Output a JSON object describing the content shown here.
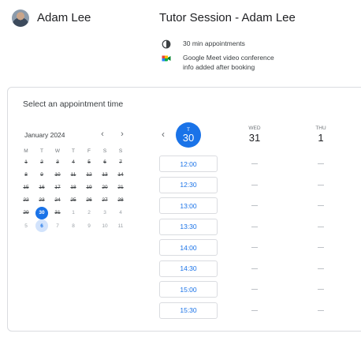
{
  "host": {
    "name": "Adam Lee"
  },
  "session": {
    "title": "Tutor Session - Adam Lee",
    "duration": "30 min appointments",
    "conference_line1": "Google Meet video conference",
    "conference_line2": "info added after booking",
    "icons": [
      "timer-icon",
      "google-meet-icon"
    ]
  },
  "picker": {
    "heading": "Select an appointment time",
    "month": "January 2024",
    "prev": "‹",
    "next": "›",
    "weekdays": [
      "M",
      "T",
      "W",
      "T",
      "F",
      "S",
      "S"
    ],
    "weeks": [
      [
        {
          "d": "1",
          "s": "past"
        },
        {
          "d": "2",
          "s": "past"
        },
        {
          "d": "3",
          "s": "past"
        },
        {
          "d": "4",
          "s": "past"
        },
        {
          "d": "5",
          "s": "past"
        },
        {
          "d": "6",
          "s": "past"
        },
        {
          "d": "7",
          "s": "past"
        }
      ],
      [
        {
          "d": "8",
          "s": "past"
        },
        {
          "d": "9",
          "s": "past"
        },
        {
          "d": "10",
          "s": "past"
        },
        {
          "d": "11",
          "s": "past"
        },
        {
          "d": "12",
          "s": "past"
        },
        {
          "d": "13",
          "s": "past"
        },
        {
          "d": "14",
          "s": "past"
        }
      ],
      [
        {
          "d": "15",
          "s": "past"
        },
        {
          "d": "16",
          "s": "past"
        },
        {
          "d": "17",
          "s": "past"
        },
        {
          "d": "18",
          "s": "past"
        },
        {
          "d": "19",
          "s": "past"
        },
        {
          "d": "20",
          "s": "past"
        },
        {
          "d": "21",
          "s": "past"
        }
      ],
      [
        {
          "d": "22",
          "s": "past"
        },
        {
          "d": "23",
          "s": "past"
        },
        {
          "d": "24",
          "s": "past"
        },
        {
          "d": "25",
          "s": "past"
        },
        {
          "d": "26",
          "s": "past"
        },
        {
          "d": "27",
          "s": "past"
        },
        {
          "d": "28",
          "s": "past"
        }
      ],
      [
        {
          "d": "29",
          "s": "past"
        },
        {
          "d": "30",
          "s": "today"
        },
        {
          "d": "31",
          "s": "past"
        },
        {
          "d": "1",
          "s": "future"
        },
        {
          "d": "2",
          "s": "future"
        },
        {
          "d": "3",
          "s": "future"
        },
        {
          "d": "4",
          "s": "future"
        }
      ],
      [
        {
          "d": "5",
          "s": "future"
        },
        {
          "d": "6",
          "s": "avail"
        },
        {
          "d": "7",
          "s": "future"
        },
        {
          "d": "8",
          "s": "future"
        },
        {
          "d": "9",
          "s": "future"
        },
        {
          "d": "10",
          "s": "future"
        },
        {
          "d": "11",
          "s": "future"
        }
      ]
    ]
  },
  "week": {
    "prev": "‹",
    "days": [
      {
        "dow": "T",
        "num": "30",
        "selected": true
      },
      {
        "dow": "WED",
        "num": "31",
        "selected": false
      },
      {
        "dow": "THU",
        "num": "1",
        "selected": false
      }
    ],
    "slots": [
      "12:00",
      "12:30",
      "13:00",
      "13:30",
      "14:00",
      "14:30",
      "15:00",
      "15:30"
    ],
    "unavailable": "—"
  },
  "colors": {
    "accent": "#1a73e8",
    "accent_light": "#d2e3fc",
    "border": "#dadce0"
  }
}
